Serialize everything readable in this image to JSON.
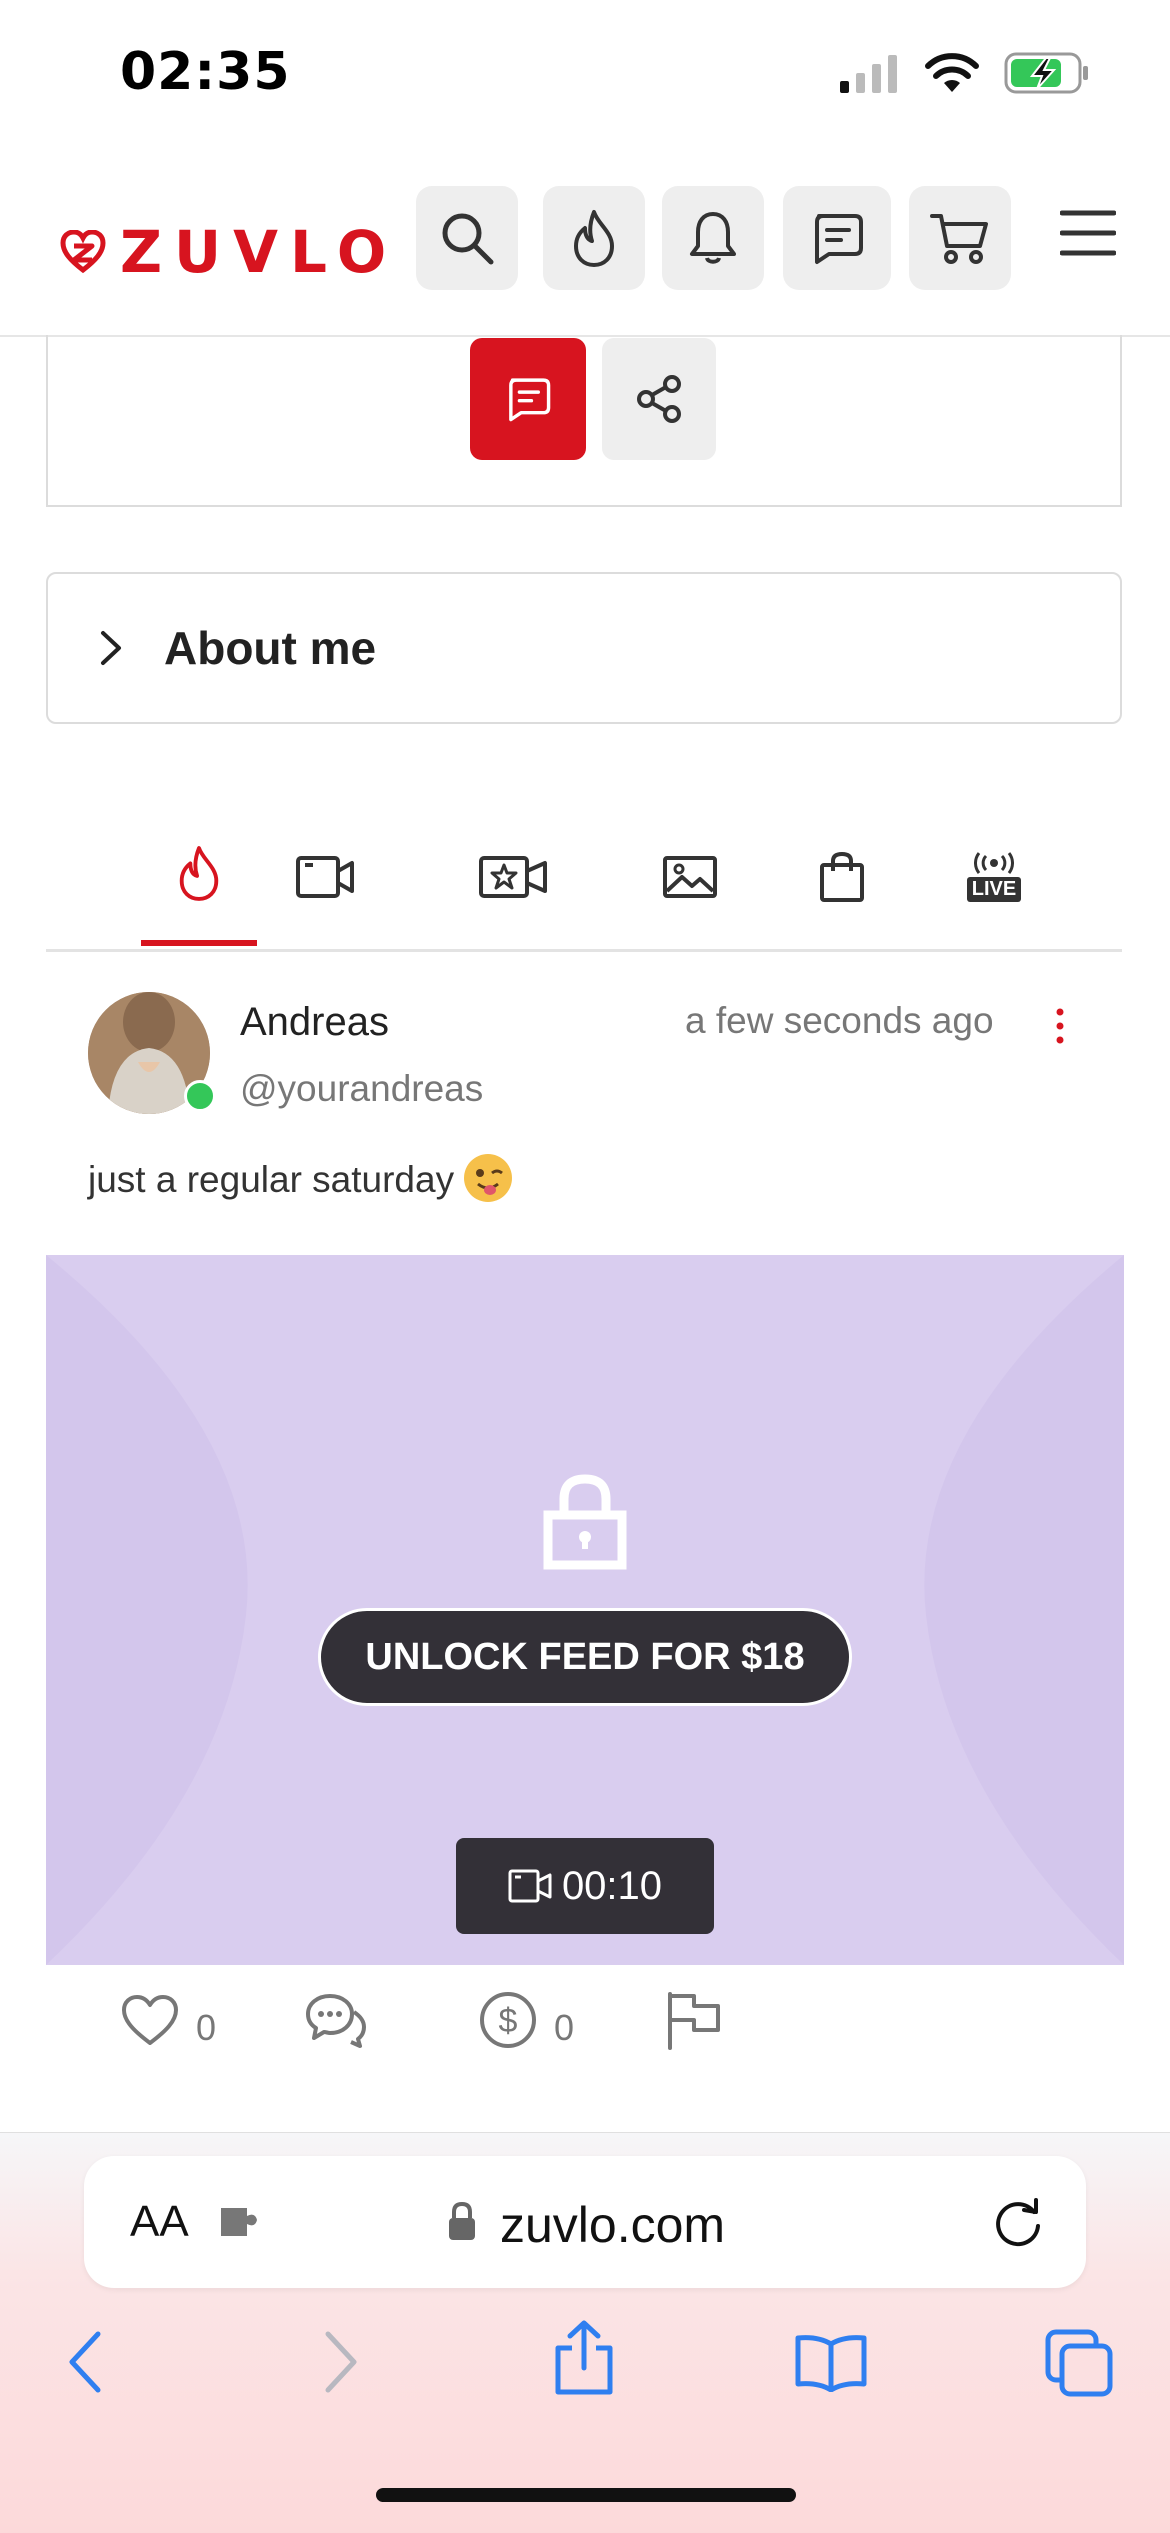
{
  "status": {
    "time": "02:35"
  },
  "header": {
    "logo_text": "ZUVLO",
    "icons": [
      "search-icon",
      "flame-icon",
      "bell-icon",
      "message-icon",
      "cart-icon",
      "menu-icon"
    ]
  },
  "about": {
    "title": "About me"
  },
  "tabs": [
    {
      "name": "feed",
      "icon": "flame-icon",
      "active": true
    },
    {
      "name": "videos",
      "icon": "video-icon",
      "active": false
    },
    {
      "name": "featured-videos",
      "icon": "star-video-icon",
      "active": false
    },
    {
      "name": "photos",
      "icon": "image-icon",
      "active": false
    },
    {
      "name": "shop",
      "icon": "bag-icon",
      "active": false
    },
    {
      "name": "live",
      "icon": "live-icon",
      "label": "LIVE",
      "active": false
    }
  ],
  "post": {
    "author": "Andreas",
    "handle": "@yourandreas",
    "time": "a few seconds ago",
    "text": "just a regular saturday",
    "unlock_label": "UNLOCK FEED FOR $18",
    "duration": "00:10",
    "likes": "0",
    "tips": "0"
  },
  "browser": {
    "aa_label": "AA",
    "url": "zuvlo.com"
  },
  "colors": {
    "brand": "#d7141f",
    "online": "#34c759",
    "ios_blue": "#2f7ff0"
  }
}
